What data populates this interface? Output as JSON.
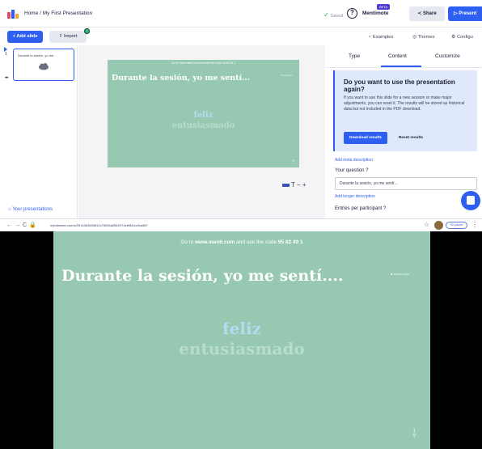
{
  "editor": {
    "breadcrumb": "Home / My First Presentation",
    "saved": "Saved",
    "brand": "Mentimote",
    "beta": "BETA",
    "share_label": "Share",
    "present_label": "Present",
    "add_slide_label": "+ Add slide",
    "import_label": "Import",
    "examples_label": "Examples",
    "themes_label": "Themes",
    "configure_label": "Configu",
    "slide_number": "1",
    "thumb_title": "Durante la sesión, yo me...",
    "your_presentations": "Your presentations",
    "slide": {
      "code_line": "Go to www.menti.com and use the code 95 82 49 1",
      "question": "Durante la sesión, yo me sentí...",
      "watermark": "Mentimeter",
      "words": [
        "feliz",
        "entusiasmado"
      ]
    },
    "panel": {
      "tabs": [
        "Type",
        "Content",
        "Customize"
      ],
      "active_tab": "Content",
      "reset_title": "Do you want to use the presentation again?",
      "reset_text": "If you want to use this slide for a new session or make major adjustments, you can reset it. The results will be stored as historical data but not included in the PDF download.",
      "download_label": "Download results",
      "reset_label": "Reset results",
      "meta_link": "Add meta description",
      "question_label": "Your question",
      "question_value": "Durante la sesión, yo me sentí...",
      "longer_link": "Add longer description",
      "entries_label": "Entries per participant"
    }
  },
  "browser": {
    "url": "mentimeter.com/s/39143b3659612c7690ba0562971ebf83/cc9ca987",
    "pause_label": "En pausa"
  },
  "viewer": {
    "code_prefix": "Go to ",
    "code_site": "www.menti.com",
    "code_middle": " and use the code ",
    "code_value": "95 82 49 1",
    "question": "Durante la sesión, yo me sentí....",
    "watermark": "Mentimeter",
    "words": [
      "feliz",
      "entusiasmado"
    ],
    "count": "1"
  },
  "colors": {
    "accent": "#2e5ff0",
    "slide_bg": "#96c8b2",
    "word_feliz": "#b3dcf0",
    "word_entusiasmado": "#b9ddcc",
    "success": "#22a35a"
  }
}
